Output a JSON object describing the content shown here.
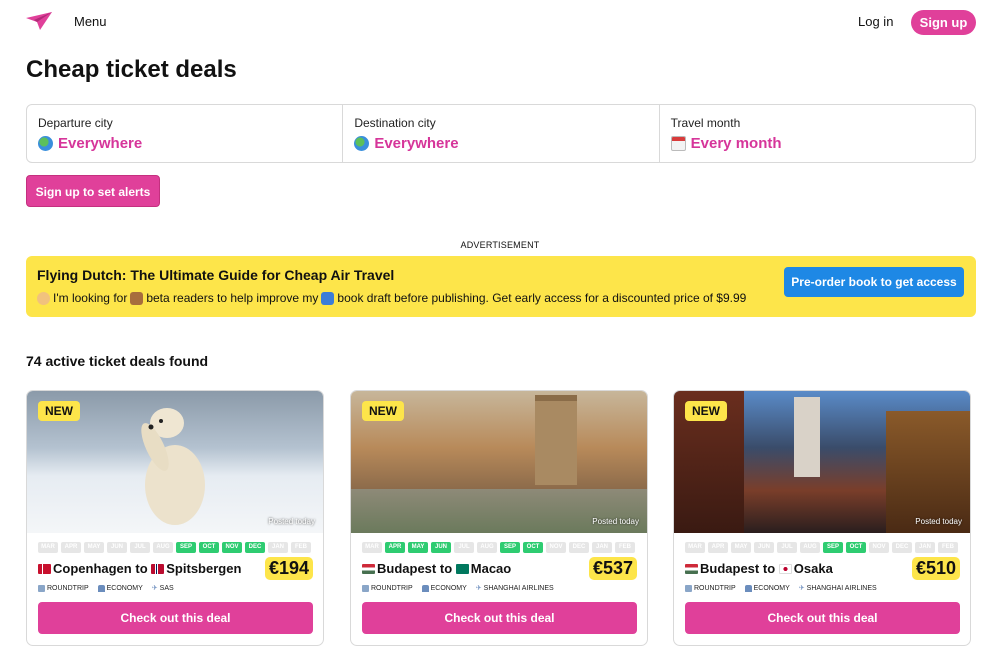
{
  "header": {
    "menu_label": "Menu",
    "login_label": "Log in",
    "signup_label": "Sign up",
    "brand_color": "#e0409a"
  },
  "page": {
    "title": "Cheap ticket deals"
  },
  "filters": [
    {
      "label": "Departure city",
      "value": "Everywhere",
      "icon": "globe-icon"
    },
    {
      "label": "Destination city",
      "value": "Everywhere",
      "icon": "globe-icon"
    },
    {
      "label": "Travel month",
      "value": "Every month",
      "icon": "calendar-icon"
    }
  ],
  "alert_button": "Sign up to set alerts",
  "ad": {
    "label": "ADVERTISEMENT",
    "title": "Flying Dutch: The Ultimate Guide for Cheap Air Travel",
    "text_1": "I'm looking for",
    "text_2": "beta readers to help improve my",
    "text_3": "book draft before publishing. Get early access for a discounted price of $9.99",
    "button": "Pre-order book to get access",
    "background": "#fde54a"
  },
  "deals_count": "74 active ticket deals found",
  "month_labels": [
    "MAR",
    "APR",
    "MAY",
    "JUN",
    "JUL",
    "AUG",
    "SEP",
    "OCT",
    "NOV",
    "DEC",
    "JAN",
    "FEB"
  ],
  "deals": [
    {
      "badge": "NEW",
      "posted": "Posted today",
      "active_months": [
        "SEP",
        "OCT",
        "NOV",
        "DEC"
      ],
      "from": "Copenhagen",
      "to_word": "to",
      "dest": "Spitsbergen",
      "price": "€194",
      "trip": "ROUNDTRIP",
      "cabin": "ECONOMY",
      "airline": "SAS",
      "button": "Check out this deal"
    },
    {
      "badge": "NEW",
      "posted": "Posted today",
      "active_months": [
        "APR",
        "MAY",
        "JUN",
        "SEP",
        "OCT"
      ],
      "from": "Budapest",
      "to_word": "to",
      "dest": "Macao",
      "price": "€537",
      "trip": "ROUNDTRIP",
      "cabin": "ECONOMY",
      "airline": "SHANGHAI AIRLINES",
      "button": "Check out this deal"
    },
    {
      "badge": "NEW",
      "posted": "Posted today",
      "active_months": [
        "SEP",
        "OCT"
      ],
      "from": "Budapest",
      "to_word": "to",
      "dest": "Osaka",
      "price": "€510",
      "trip": "ROUNDTRIP",
      "cabin": "ECONOMY",
      "airline": "SHANGHAI AIRLINES",
      "button": "Check out this deal"
    }
  ]
}
